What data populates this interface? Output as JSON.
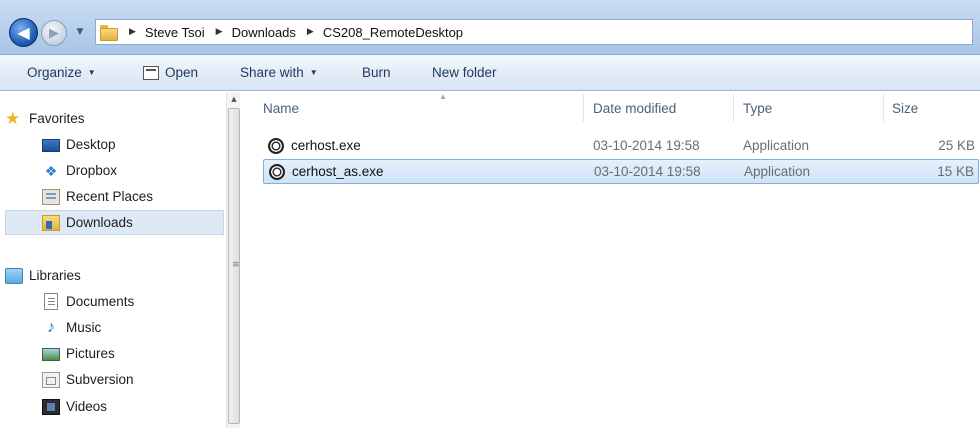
{
  "address_bar": {
    "crumbs": [
      "Steve Tsoi",
      "Downloads",
      "CS208_RemoteDesktop"
    ]
  },
  "toolbar": {
    "organize_label": "Organize",
    "open_label": "Open",
    "share_label": "Share with",
    "burn_label": "Burn",
    "new_folder_label": "New folder"
  },
  "sidebar": {
    "favorites": {
      "label": "Favorites",
      "items": [
        {
          "label": "Desktop",
          "icon": "desktop-icon"
        },
        {
          "label": "Dropbox",
          "icon": "dropbox-icon"
        },
        {
          "label": "Recent Places",
          "icon": "recent-places-icon"
        },
        {
          "label": "Downloads",
          "icon": "downloads-folder-icon",
          "selected": true
        }
      ]
    },
    "libraries": {
      "label": "Libraries",
      "items": [
        {
          "label": "Documents",
          "icon": "documents-icon"
        },
        {
          "label": "Music",
          "icon": "music-icon"
        },
        {
          "label": "Pictures",
          "icon": "pictures-icon"
        },
        {
          "label": "Subversion",
          "icon": "subversion-icon"
        },
        {
          "label": "Videos",
          "icon": "videos-icon"
        }
      ]
    }
  },
  "file_list": {
    "columns": [
      "Name",
      "Date modified",
      "Type",
      "Size"
    ],
    "rows": [
      {
        "name": "cerhost.exe",
        "date": "03-10-2014 19:58",
        "type": "Application",
        "size": "25 KB",
        "selected": false
      },
      {
        "name": "cerhost_as.exe",
        "date": "03-10-2014 19:58",
        "type": "Application",
        "size": "15 KB",
        "selected": true
      }
    ]
  },
  "colors": {
    "selection_fill": "#cfe3f8",
    "selection_border": "#84acdd",
    "toolbar_text": "#1e395b"
  }
}
